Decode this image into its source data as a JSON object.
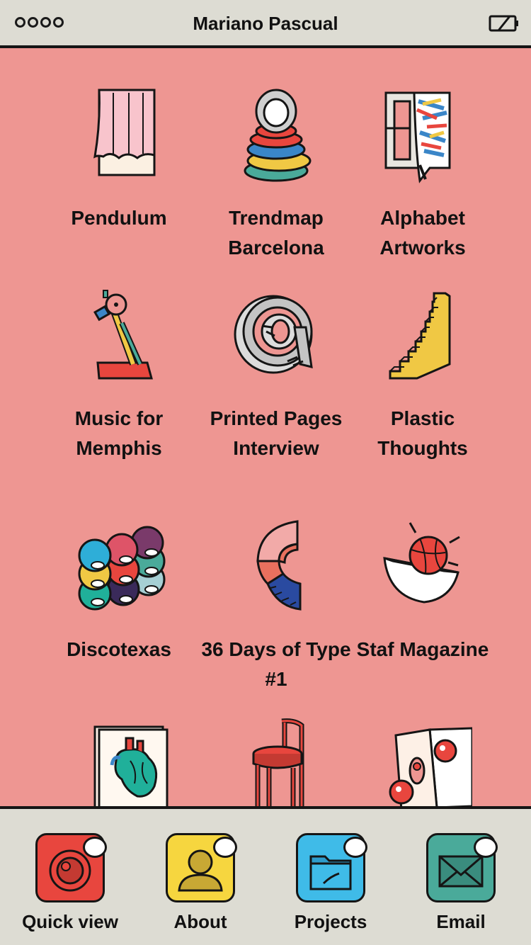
{
  "status_bar": {
    "title": "Mariano Pascual",
    "signal_icon": "signal-dots-icon",
    "battery_icon": "battery-empty-icon"
  },
  "colors": {
    "background": "#ee9692",
    "bar": "#dddcd3",
    "ink": "#151515"
  },
  "projects": [
    {
      "label": "Pendulum",
      "icon": "curtain-icon"
    },
    {
      "label": "Trendmap Barcelona",
      "icon": "stacked-rings-icon"
    },
    {
      "label": "Alphabet Artworks",
      "icon": "painted-frame-icon"
    },
    {
      "label": "Music for Memphis",
      "icon": "record-player-arm-icon"
    },
    {
      "label": "Printed Pages Interview",
      "icon": "at-sign-icon"
    },
    {
      "label": "Plastic Thoughts",
      "icon": "staircase-icon"
    },
    {
      "label": "Discotexas",
      "icon": "colored-discs-icon"
    },
    {
      "label": "36 Days of Type #1",
      "icon": "letter-c-icon"
    },
    {
      "label": "Staf Magazine",
      "icon": "bowl-ball-icon"
    },
    {
      "label": "",
      "icon": "anatomical-heart-book-icon"
    },
    {
      "label": "",
      "icon": "red-chair-icon"
    },
    {
      "label": "",
      "icon": "folded-card-balls-icon"
    }
  ],
  "tabs": [
    {
      "label": "Quick view",
      "icon": "camera-icon",
      "color": "#e8463e"
    },
    {
      "label": "About",
      "icon": "person-icon",
      "color": "#f6d63f"
    },
    {
      "label": "Projects",
      "icon": "folder-icon",
      "color": "#3fbbe8"
    },
    {
      "label": "Email",
      "icon": "envelope-icon",
      "color": "#4aaa9a"
    }
  ]
}
